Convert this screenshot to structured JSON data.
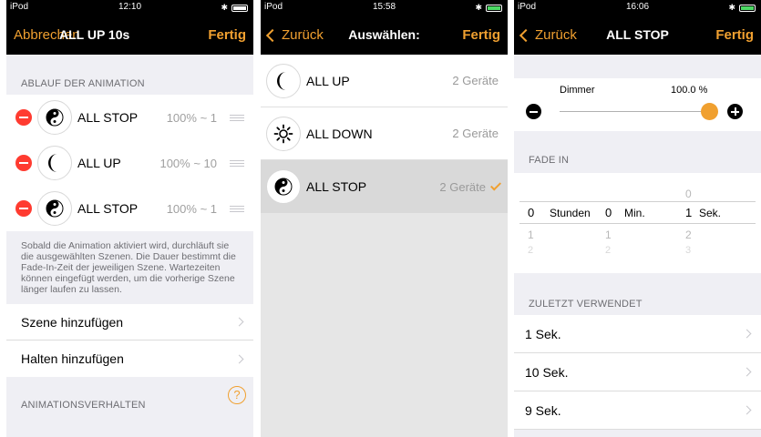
{
  "panel1": {
    "status": {
      "carrier": "iPod",
      "time": "12:10"
    },
    "nav": {
      "left": "Abbrechen",
      "title": "ALL UP  10s",
      "right": "Fertig"
    },
    "section_header": "ABLAUF DER ANIMATION",
    "scenes": [
      {
        "icon": "yin-yang-icon",
        "name": "ALL STOP",
        "value": "100% ~ 1"
      },
      {
        "icon": "moon-icon",
        "name": "ALL UP",
        "value": "100% ~ 10"
      },
      {
        "icon": "yin-yang-icon",
        "name": "ALL STOP",
        "value": "100% ~ 1"
      }
    ],
    "note": "Sobald die Animation aktiviert wird, durchläuft sie die ausgewählten Szenen. Die Dauer bestimmt die Fade-In-Zeit der jeweiligen Szene. Wartezeiten können eingefügt werden, um die vorherige Szene länger laufen zu lassen.",
    "actions": [
      "Szene hinzufügen",
      "Halten hinzufügen"
    ],
    "section_header2": "ANIMATIONSVERHALTEN",
    "help_icon": "?"
  },
  "panel2": {
    "status": {
      "carrier": "iPod",
      "time": "15:58"
    },
    "nav": {
      "left": "Zurück",
      "title": "Auswählen:",
      "right": "Fertig"
    },
    "rows": [
      {
        "icon": "moon-icon",
        "name": "ALL UP",
        "count": "2 Geräte",
        "selected": false
      },
      {
        "icon": "sun-icon",
        "name": "ALL DOWN",
        "count": "2 Geräte",
        "selected": false
      },
      {
        "icon": "yin-yang-icon",
        "name": "ALL STOP",
        "count": "2 Geräte",
        "selected": true
      }
    ]
  },
  "panel3": {
    "status": {
      "carrier": "iPod",
      "time": "16:06"
    },
    "nav": {
      "left": "Zurück",
      "title": "ALL STOP",
      "right": "Fertig"
    },
    "dimmer": {
      "label": "Dimmer",
      "value_text": "100.0 %",
      "value": 1.0
    },
    "fade_header": "FADE IN",
    "picker": {
      "hours": {
        "above": "",
        "selected": "0",
        "below1": "1",
        "below2": "2",
        "unit": "Stunden"
      },
      "minutes": {
        "above": "",
        "selected": "0",
        "below1": "1",
        "below2": "2",
        "unit": "Min."
      },
      "seconds": {
        "above": "0",
        "selected": "1",
        "below1": "2",
        "below2": "3",
        "unit": "Sek."
      }
    },
    "recent_header": "ZULETZT VERWENDET",
    "recent": [
      "1 Sek.",
      "10 Sek.",
      "9 Sek."
    ],
    "accent": "#f0a030"
  }
}
